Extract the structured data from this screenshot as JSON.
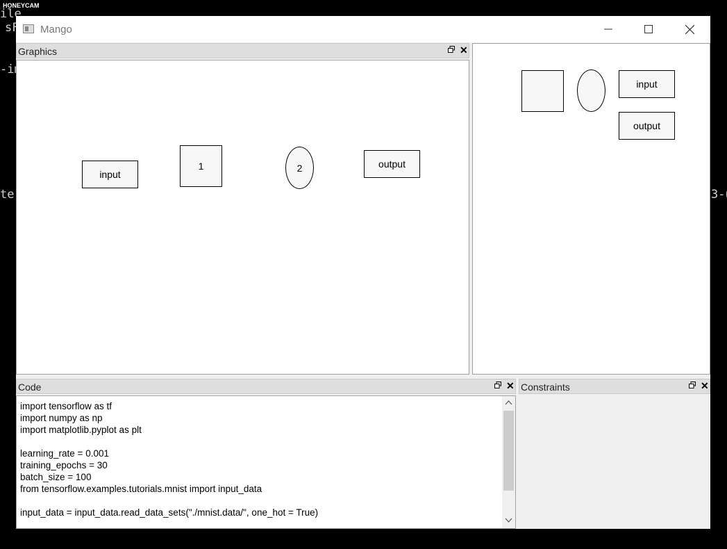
{
  "background": {
    "watermark": "HONEYCAM",
    "fragments": [
      "ile",
      "sF",
      "-im",
      "te.",
      "3-u"
    ]
  },
  "window": {
    "title": "Mango",
    "icons": {
      "app": "app-window-icon",
      "minimize": "minimize-icon",
      "maximize": "maximize-icon",
      "close": "close-icon"
    }
  },
  "graphics_panel": {
    "title": "Graphics",
    "nodes": [
      {
        "shape": "rect",
        "label": "input"
      },
      {
        "shape": "square",
        "label": "1"
      },
      {
        "shape": "ellipse",
        "label": "2"
      },
      {
        "shape": "rect",
        "label": "output"
      }
    ]
  },
  "palette_panel": {
    "items": [
      {
        "shape": "square",
        "label": ""
      },
      {
        "shape": "ellipse",
        "label": ""
      },
      {
        "shape": "rect",
        "label": "input"
      },
      {
        "shape": "rect",
        "label": "output"
      }
    ]
  },
  "code_panel": {
    "title": "Code",
    "lines": [
      "import tensorflow as tf",
      "import numpy as np",
      "import matplotlib.pyplot as plt",
      "",
      "learning_rate = 0.001",
      "training_epochs = 30",
      "batch_size = 100",
      "from tensorflow.examples.tutorials.mnist import input_data",
      "",
      "input_data = input_data.read_data_sets(\"./mnist.data/\", one_hot = True)"
    ]
  },
  "constraints_panel": {
    "title": "Constraints"
  }
}
